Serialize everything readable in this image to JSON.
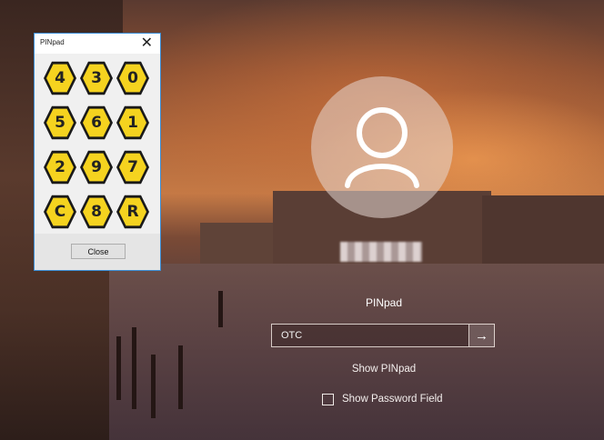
{
  "pinpad": {
    "title": "PINpad",
    "close_glyph": "✕",
    "keys": [
      "4",
      "3",
      "0",
      "5",
      "6",
      "1",
      "2",
      "9",
      "7",
      "C",
      "8",
      "R"
    ],
    "close_label": "Close",
    "key_color": "#f5d31f"
  },
  "login": {
    "pin_label": "PINpad",
    "pin_value": "OTC",
    "submit_glyph": "→",
    "show_pinpad_label": "Show PINpad",
    "show_password_label": "Show Password Field"
  }
}
